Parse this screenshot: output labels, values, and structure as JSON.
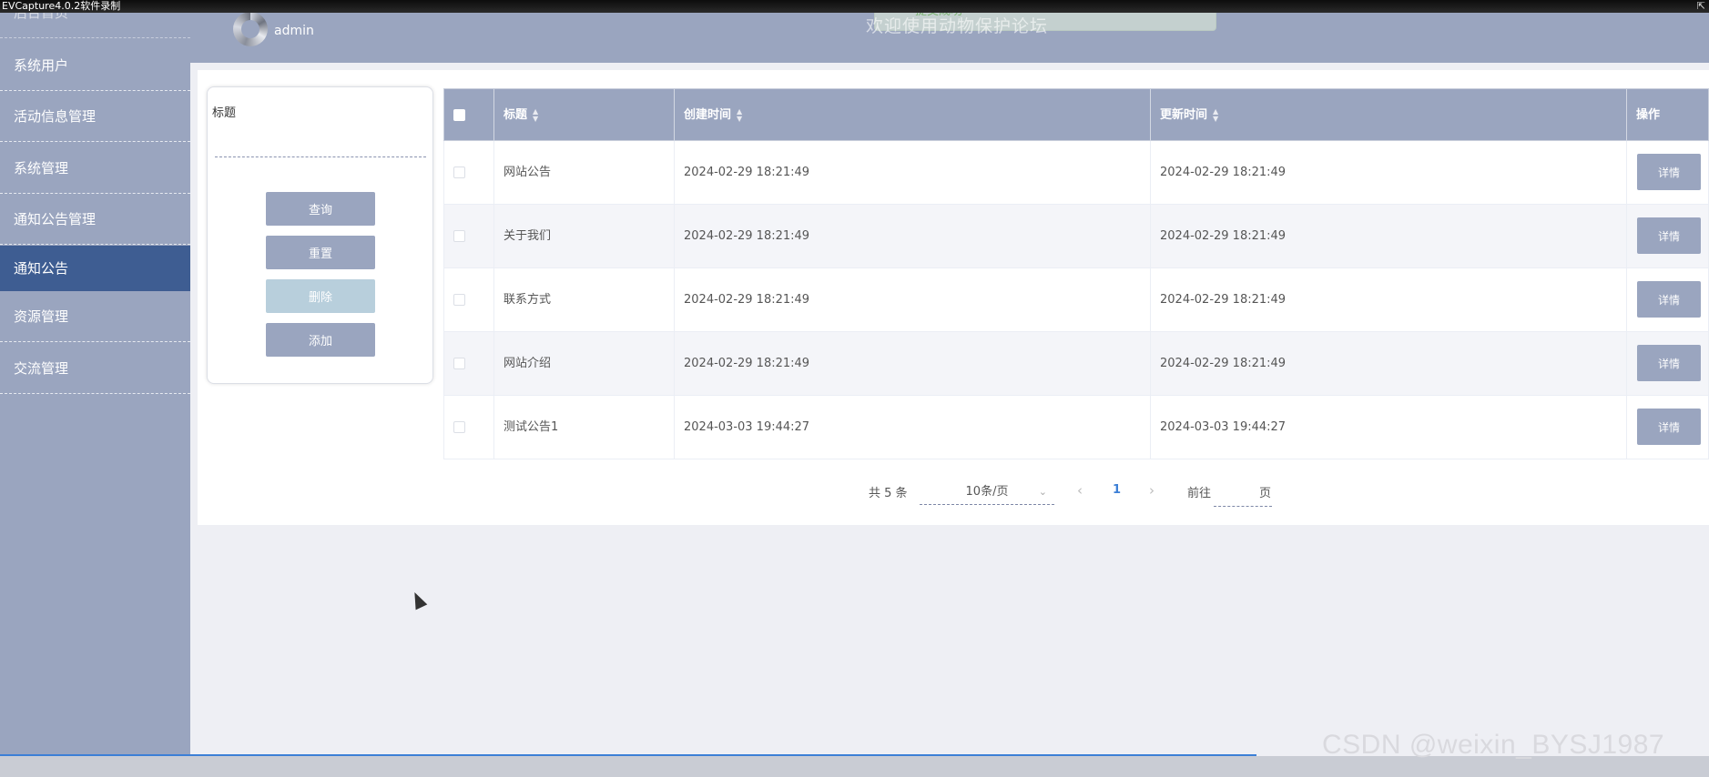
{
  "recorder": {
    "title": "EVCapture4.0.2软件录制"
  },
  "header": {
    "username": "admin",
    "title": "欢迎使用动物保护论坛",
    "toast": "提交成功"
  },
  "sidebar": {
    "items": [
      {
        "label": "后台首页"
      },
      {
        "label": "系统用户"
      },
      {
        "label": "活动信息管理"
      },
      {
        "label": "系统管理"
      },
      {
        "label": "通知公告管理"
      },
      {
        "label": "通知公告",
        "active": true
      },
      {
        "label": "资源管理"
      },
      {
        "label": "交流管理"
      }
    ]
  },
  "search": {
    "label": "标题",
    "value": "",
    "buttons": {
      "query": "查询",
      "reset": "重置",
      "delete": "删除",
      "add": "添加"
    }
  },
  "table": {
    "columns": {
      "title": "标题",
      "created": "创建时间",
      "updated": "更新时间",
      "actions": "操作"
    },
    "rows": [
      {
        "title": "网站公告",
        "created": "2024-02-29 18:21:49",
        "updated": "2024-02-29 18:21:49",
        "action": "详情"
      },
      {
        "title": "关于我们",
        "created": "2024-02-29 18:21:49",
        "updated": "2024-02-29 18:21:49",
        "action": "详情"
      },
      {
        "title": "联系方式",
        "created": "2024-02-29 18:21:49",
        "updated": "2024-02-29 18:21:49",
        "action": "详情"
      },
      {
        "title": "网站介绍",
        "created": "2024-02-29 18:21:49",
        "updated": "2024-02-29 18:21:49",
        "action": "详情"
      },
      {
        "title": "测试公告1",
        "created": "2024-03-03 19:44:27",
        "updated": "2024-03-03 19:44:27",
        "action": "详情"
      }
    ]
  },
  "pagination": {
    "total": "共 5 条",
    "page_size": "10条/页",
    "prev": "‹",
    "current": "1",
    "next": "›",
    "goto_prefix": "前往",
    "goto_suffix": "页"
  },
  "watermark": "CSDN @weixin_BYSJ1987",
  "colors": {
    "sidebar": "#9aa5bf",
    "active": "#3e5d92",
    "button": "#9aa5bf",
    "accent": "#3c7fd6"
  }
}
